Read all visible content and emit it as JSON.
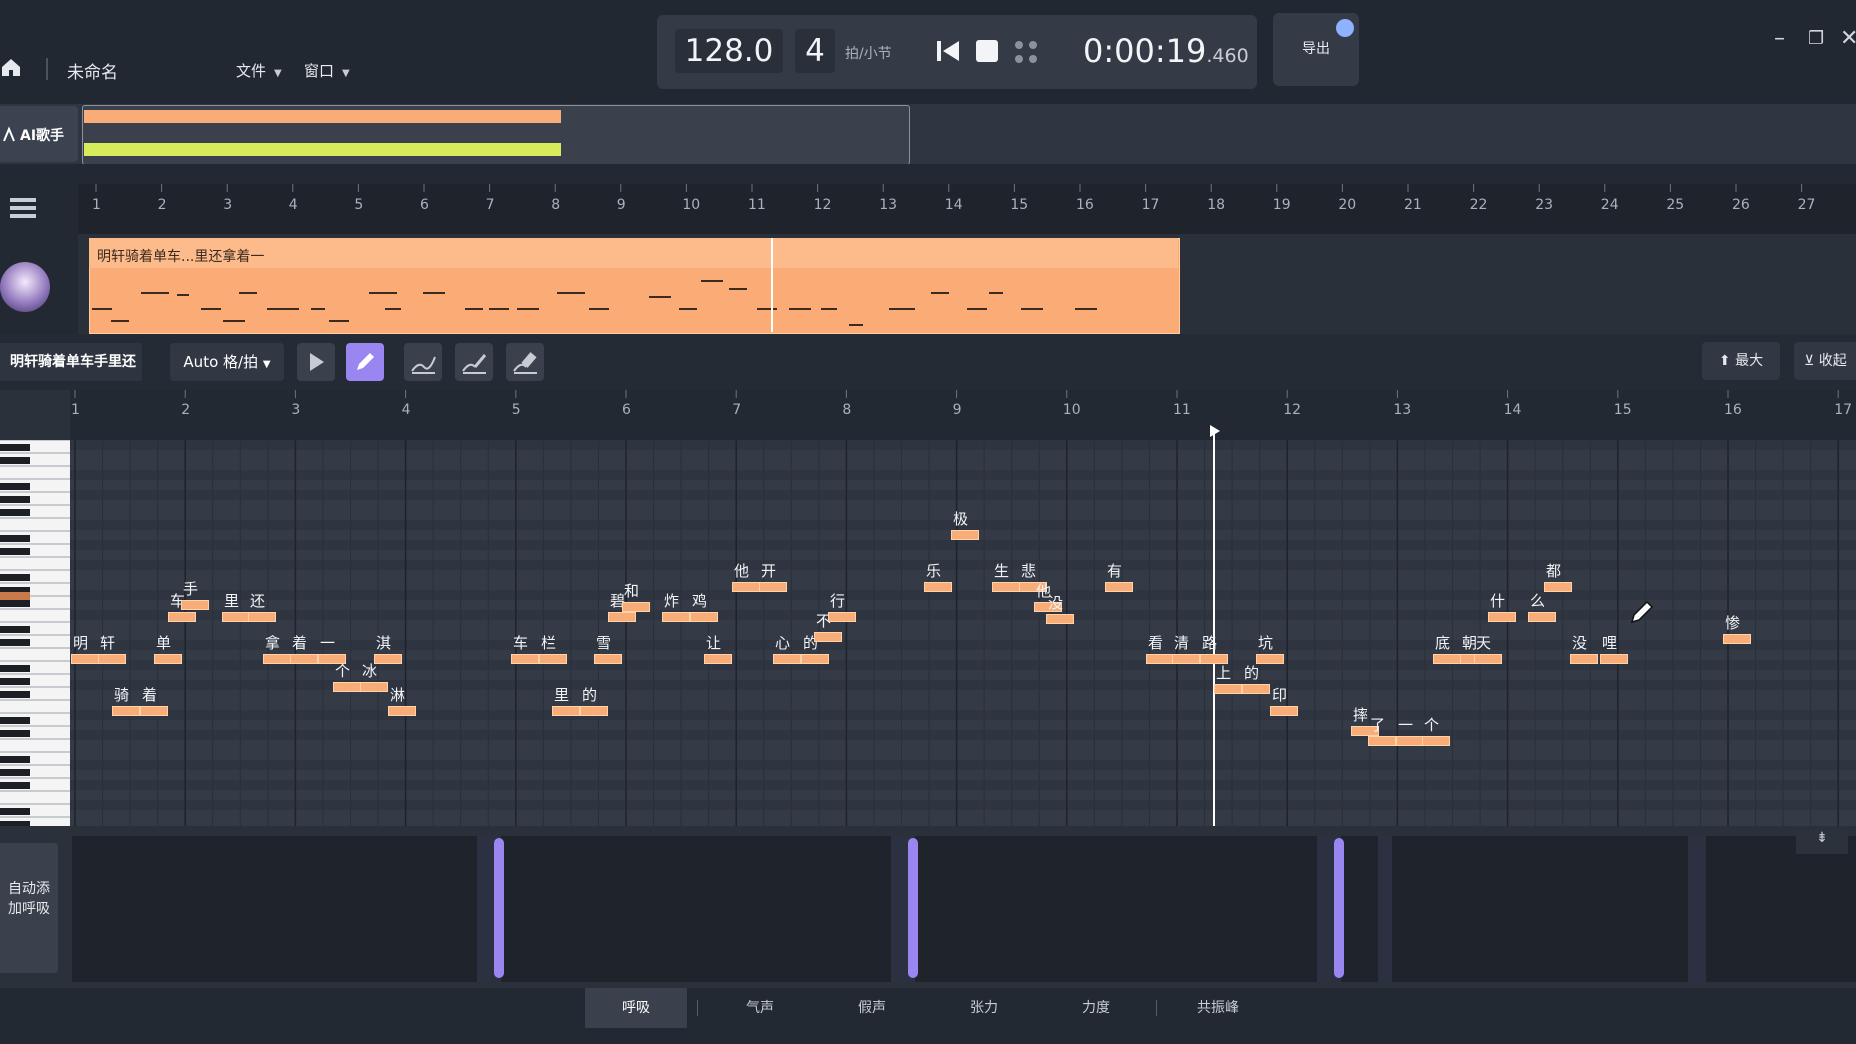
{
  "app": {
    "project_title": "未命名"
  },
  "menu": [
    {
      "label": "文件"
    },
    {
      "label": "窗口"
    }
  ],
  "transport": {
    "bpm": "128.0",
    "beats": "4",
    "beat_unit": "拍/小节",
    "time": "0:00:19",
    "time_ms": ".460"
  },
  "export": {
    "label": "导出"
  },
  "ai_singer": {
    "label": "AI歌手"
  },
  "clip": {
    "title": "明轩骑着单车...里还拿着一"
  },
  "arrangement_ruler": [
    "1",
    "2",
    "3",
    "4",
    "5",
    "6",
    "7",
    "8",
    "9",
    "10",
    "11",
    "12",
    "13",
    "14",
    "15",
    "16",
    "17",
    "18",
    "19",
    "20",
    "21",
    "22",
    "23",
    "24",
    "25",
    "26",
    "27"
  ],
  "toolbar": {
    "track_name": "明轩骑着单车手里还",
    "snap": "Auto 格/拍",
    "max_label": "最大",
    "collapse_label": "收起"
  },
  "roll_ruler": [
    "1",
    "2",
    "3",
    "4",
    "5",
    "6",
    "7",
    "8",
    "9",
    "10",
    "11",
    "12",
    "13",
    "14",
    "15",
    "16",
    "17"
  ],
  "lyrics": [
    "明",
    "轩",
    "骑",
    "着",
    "单",
    "车",
    "手",
    "里",
    "还",
    "拿",
    "着",
    "一",
    "个",
    "冰",
    "淇",
    "淋",
    "车",
    "栏",
    "里",
    "的",
    "雪",
    "碧",
    "和",
    "炸",
    "鸡",
    "让",
    "他",
    "开",
    "心",
    "的",
    "不",
    "行",
    "乐",
    "极",
    "生",
    "悲",
    "他",
    "没",
    "有",
    "看",
    "清",
    "路",
    "上",
    "的",
    "坑",
    "印",
    "摔",
    "了",
    "一",
    "个",
    "底",
    "朝",
    "天",
    "什",
    "么",
    "都",
    "没",
    "哩",
    "惨"
  ],
  "breath": {
    "auto_label": "自动添加呼吸"
  },
  "tabs": [
    {
      "label": "呼吸"
    },
    {
      "label": "气声"
    },
    {
      "label": "假声"
    },
    {
      "label": "张力"
    },
    {
      "label": "力度"
    },
    {
      "label": "共振峰"
    }
  ],
  "colors": {
    "accent": "#9a86f0",
    "note": "#f8ad78",
    "clip": "#fbab76",
    "grid": "#323944"
  }
}
